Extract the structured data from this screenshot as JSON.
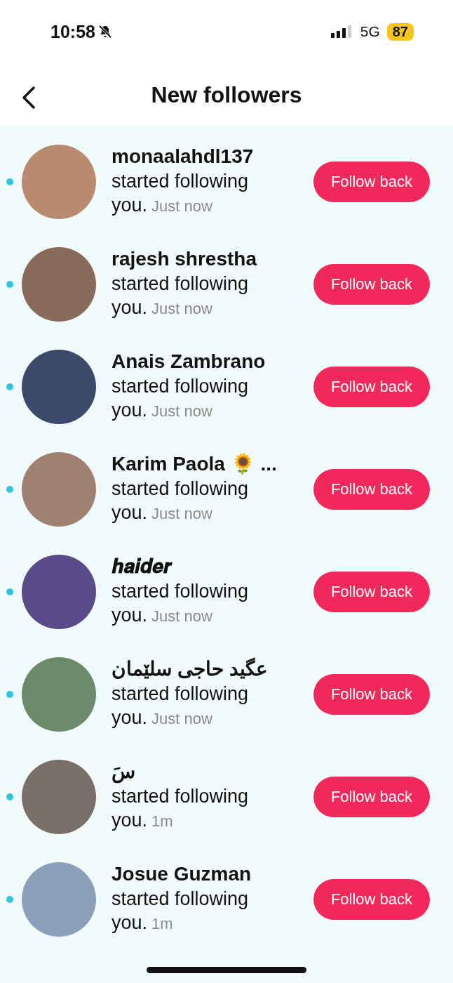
{
  "status_bar": {
    "time": "10:58",
    "network": "5G",
    "battery": "87"
  },
  "header": {
    "title": "New followers"
  },
  "followers": [
    {
      "name": "monaalahdl137",
      "message": "started following",
      "message_end": "you.",
      "time": "Just now",
      "unread": true,
      "button": "Follow back"
    },
    {
      "name": "rajesh shrestha",
      "message": "started following",
      "message_end": "you.",
      "time": "Just now",
      "unread": true,
      "button": "Follow back"
    },
    {
      "name": "Anais Zambrano",
      "message": "started following",
      "message_end": "you.",
      "time": "Just now",
      "unread": true,
      "button": "Follow back"
    },
    {
      "name": "Karim Paola 🌻 ...",
      "message": "started following",
      "message_end": "you.",
      "time": "Just now",
      "unread": true,
      "button": "Follow back"
    },
    {
      "name": "𝒉𝒂𝒊𝒅𝒆𝒓",
      "message": "started following",
      "message_end": "you.",
      "time": "Just now",
      "unread": true,
      "button": "Follow back"
    },
    {
      "name": "عگید حاجی سلێمان",
      "message": "started following",
      "message_end": "you.",
      "time": "Just now",
      "unread": true,
      "button": "Follow back"
    },
    {
      "name": "سَ",
      "message": "started following",
      "message_end": "you.",
      "time": "1m",
      "unread": true,
      "button": "Follow back"
    },
    {
      "name": "Josue Guzman",
      "message": "started following",
      "message_end": "you.",
      "time": "1m",
      "unread": true,
      "button": "Follow back"
    }
  ]
}
